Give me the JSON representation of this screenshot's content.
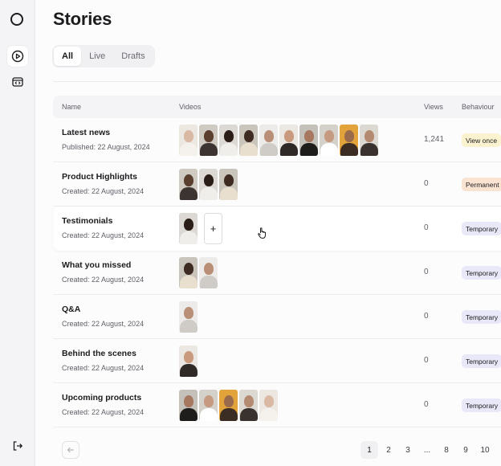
{
  "page": {
    "title": "Stories"
  },
  "tabs": [
    {
      "label": "All",
      "active": true
    },
    {
      "label": "Live",
      "active": false
    },
    {
      "label": "Drafts",
      "active": false
    }
  ],
  "sidebar": {
    "items": [
      {
        "icon": "play-circle-icon",
        "active": true
      },
      {
        "icon": "code-window-icon",
        "active": false
      }
    ],
    "logout_icon": "logout-icon"
  },
  "table": {
    "columns": {
      "name": "Name",
      "videos": "Videos",
      "views": "Views",
      "behaviour": "Behaviour"
    },
    "rows": [
      {
        "name": "Latest news",
        "date": "Published: 22 August, 2024",
        "videos": 10,
        "views": "1,241",
        "behaviour": "View once",
        "behaviour_color": "#fbf3d0"
      },
      {
        "name": "Product Highlights",
        "date": "Created: 22 August, 2024",
        "videos": 3,
        "views": "0",
        "behaviour": "Permanent",
        "behaviour_color": "#fbe3d2"
      },
      {
        "name": "Testimonials",
        "date": "Created: 22 August, 2024",
        "videos": 1,
        "views": "0",
        "behaviour": "Temporary",
        "behaviour_color": "#e9e8f8",
        "hovered": true,
        "add_label": "+"
      },
      {
        "name": "What you missed",
        "date": "Created: 22 August, 2024",
        "videos": 2,
        "views": "0",
        "behaviour": "Temporary",
        "behaviour_color": "#e9e8f8"
      },
      {
        "name": "Q&A",
        "date": "Created: 22 August, 2024",
        "videos": 1,
        "views": "0",
        "behaviour": "Temporary",
        "behaviour_color": "#e9e8f8"
      },
      {
        "name": "Behind the scenes",
        "date": "Created: 22 August, 2024",
        "videos": 1,
        "views": "0",
        "behaviour": "Temporary",
        "behaviour_color": "#e9e8f8"
      },
      {
        "name": "Upcoming products",
        "date": "Created: 22 August, 2024",
        "videos": 5,
        "views": "0",
        "behaviour": "Temporary",
        "behaviour_color": "#e9e8f8"
      }
    ]
  },
  "pagination": {
    "prev_icon": "arrow-left-icon",
    "pages": [
      "1",
      "2",
      "3",
      "...",
      "8",
      "9",
      "10"
    ],
    "current": "1"
  }
}
